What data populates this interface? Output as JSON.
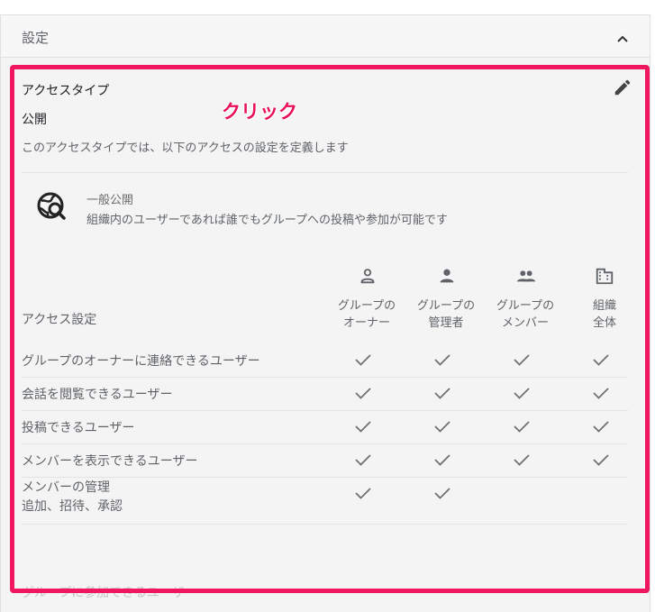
{
  "settings_panel": {
    "title": "設定",
    "access_type_label": "アクセスタイプ",
    "access_type_value": "公開",
    "description": "このアクセスタイプでは、以下のアクセスの設定を定義します",
    "public_title": "一般公開",
    "public_description": "組織内のユーザーであれば誰でもグループへの投稿や参加が可能です",
    "annotation": "クリック",
    "access_settings_title": "アクセス設定",
    "columns": [
      {
        "line1": "グループの",
        "line2": "オーナー",
        "icon": "person-outline-icon"
      },
      {
        "line1": "グループの",
        "line2": "管理者",
        "icon": "person-icon"
      },
      {
        "line1": "グループの",
        "line2": "メンバー",
        "icon": "group-icon"
      },
      {
        "line1": "組織",
        "line2": "全体",
        "icon": "building-icon"
      }
    ],
    "rows": [
      {
        "label": "グループのオーナーに連絡できるユーザー",
        "checks": [
          true,
          true,
          true,
          true
        ]
      },
      {
        "label": "会話を閲覧できるユーザー",
        "checks": [
          true,
          true,
          true,
          true
        ]
      },
      {
        "label": "投稿できるユーザー",
        "checks": [
          true,
          true,
          true,
          true
        ]
      },
      {
        "label": "メンバーを表示できるユーザー",
        "checks": [
          true,
          true,
          true,
          true
        ]
      },
      {
        "label": "メンバーの管理",
        "sublabel": "追加、招待、承認",
        "checks": [
          true,
          true,
          false,
          false
        ]
      }
    ],
    "next_row_label": "グループに参加できるユーザー",
    "colors": {
      "highlight": "#f0175f",
      "annotation": "#e8105a",
      "check": "#707070"
    }
  }
}
